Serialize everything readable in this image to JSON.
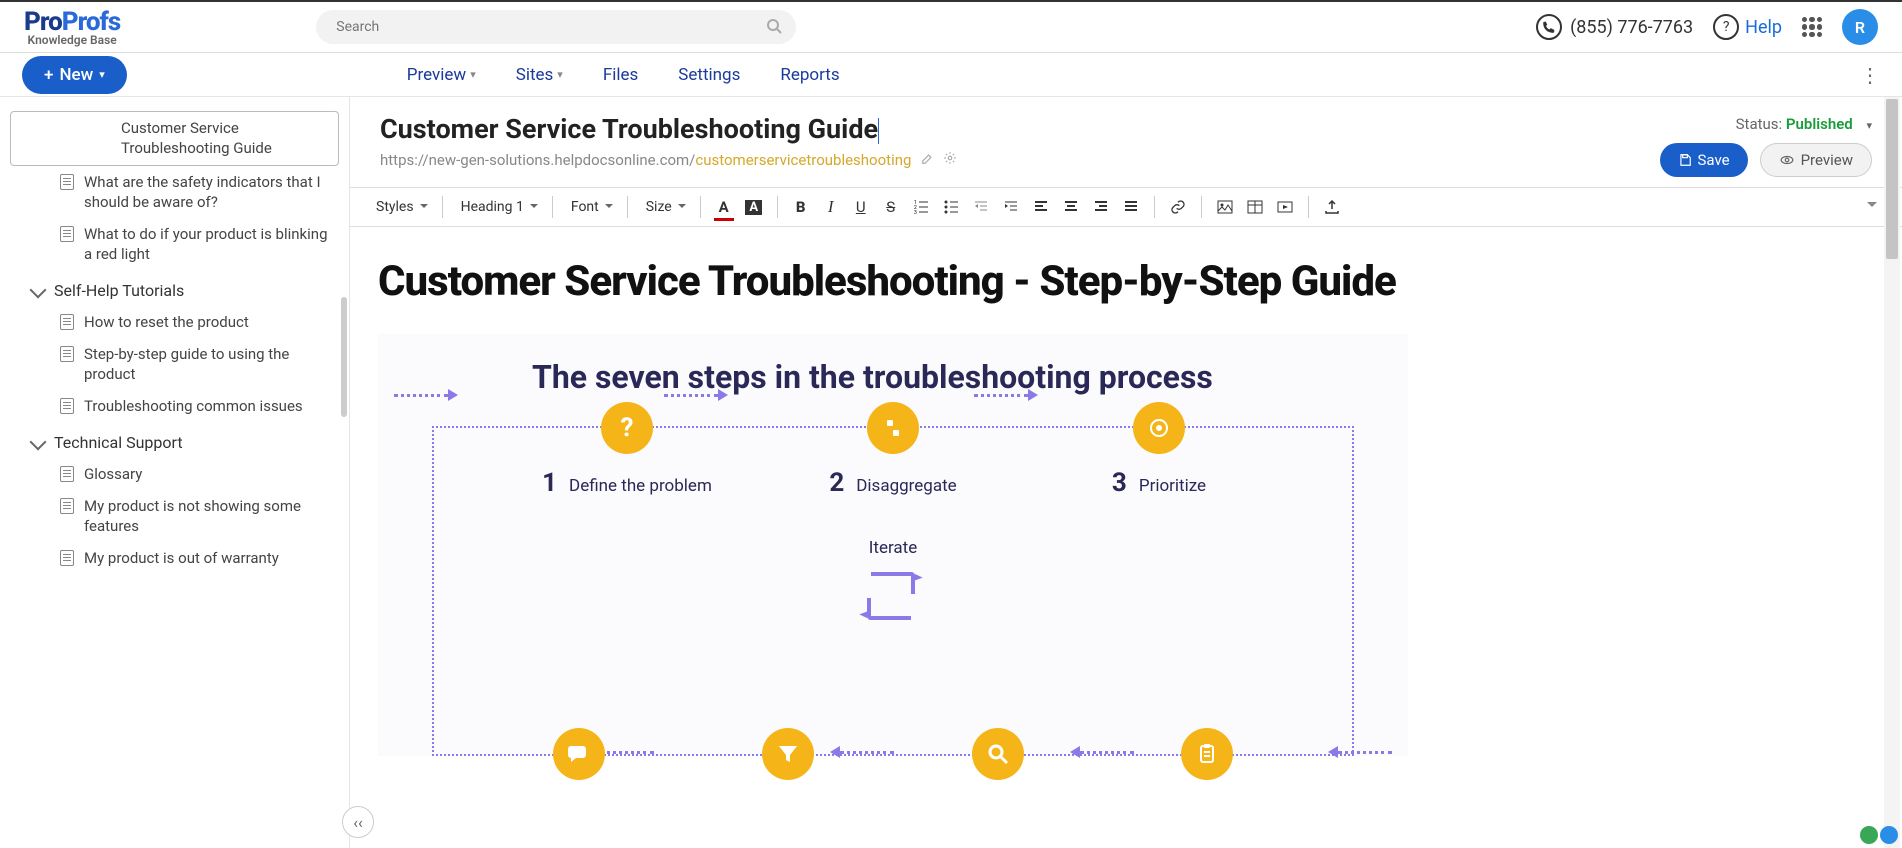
{
  "brand": {
    "p1": "Pro",
    "p2": "Profs",
    "sub": "Knowledge Base"
  },
  "search": {
    "placeholder": "Search"
  },
  "top": {
    "phone": "(855) 776-7763",
    "help": "Help",
    "avatar": "R"
  },
  "secondary": {
    "new_label": "New"
  },
  "tabs": {
    "preview": "Preview",
    "sites": "Sites",
    "files": "Files",
    "settings": "Settings",
    "reports": "Reports"
  },
  "sidebar": {
    "items": [
      {
        "label": "Customer Service Troubleshooting Guide",
        "selected": true,
        "icon": false
      },
      {
        "label": "What are the safety indicators that I should be aware of?",
        "icon": true
      },
      {
        "label": "What to do if your product is blinking a red light",
        "icon": true
      }
    ],
    "sections": [
      {
        "title": "Self-Help Tutorials",
        "items": [
          "How to reset the product",
          "Step-by-step guide to using the product",
          "Troubleshooting common issues"
        ]
      },
      {
        "title": "Technical Support",
        "items": [
          "Glossary",
          "My product is not showing some features",
          "My product is out of warranty"
        ]
      }
    ]
  },
  "page": {
    "title": "Customer Service Troubleshooting Guide",
    "url_prefix": "https://new-gen-solutions.helpdocsonline.com/",
    "url_slug": "customerservicetroubleshooting",
    "status_label": "Status:",
    "status_value": "Published",
    "save": "Save",
    "preview": "Preview"
  },
  "toolbar": {
    "styles": "Styles",
    "heading": "Heading 1",
    "font": "Font",
    "size": "Size"
  },
  "content": {
    "h1": "Customer Service Troubleshooting - Step-by-Step Guide",
    "diagram_title": "The seven steps in the troubleshooting process",
    "steps": [
      {
        "num": "1",
        "label": "Define the problem"
      },
      {
        "num": "2",
        "label": "Disaggregate"
      },
      {
        "num": "3",
        "label": "Prioritize"
      }
    ],
    "iterate": "Iterate"
  }
}
